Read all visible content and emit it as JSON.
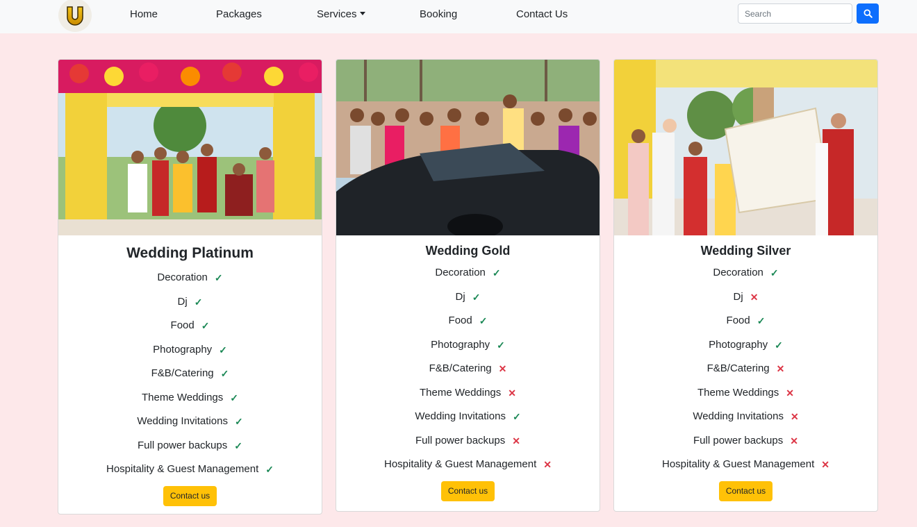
{
  "nav": {
    "logo_icon": "u-logo",
    "links": [
      {
        "label": "Home"
      },
      {
        "label": "Packages"
      },
      {
        "label": "Services"
      },
      {
        "label": "Booking"
      },
      {
        "label": "Contact Us"
      }
    ],
    "search_placeholder": "Search",
    "search_icon": "search-icon"
  },
  "colors": {
    "page_bg": "#fde8ea",
    "navbar_bg": "#f8f9fa",
    "primary": "#0d6efd",
    "warning": "#ffc107",
    "success": "#198754",
    "danger": "#dc3545"
  },
  "packages": [
    {
      "title": "Wedding Platinum",
      "features": [
        {
          "label": "Decoration",
          "included": true
        },
        {
          "label": "Dj",
          "included": true
        },
        {
          "label": "Food",
          "included": true
        },
        {
          "label": "Photography",
          "included": true
        },
        {
          "label": "F&B/Catering",
          "included": true
        },
        {
          "label": "Theme Weddings",
          "included": true
        },
        {
          "label": "Wedding Invitations",
          "included": true
        },
        {
          "label": "Full power backups",
          "included": true
        },
        {
          "label": "Hospitality & Guest Management",
          "included": true
        }
      ],
      "button": "Contact us"
    },
    {
      "title": "Wedding Gold",
      "features": [
        {
          "label": "Decoration",
          "included": true
        },
        {
          "label": "Dj",
          "included": true
        },
        {
          "label": "Food",
          "included": true
        },
        {
          "label": "Photography",
          "included": true
        },
        {
          "label": "F&B/Catering",
          "included": false
        },
        {
          "label": "Theme Weddings",
          "included": false
        },
        {
          "label": "Wedding Invitations",
          "included": true
        },
        {
          "label": "Full power backups",
          "included": false
        },
        {
          "label": "Hospitality & Guest Management",
          "included": false
        }
      ],
      "button": "Contact us"
    },
    {
      "title": "Wedding Silver",
      "features": [
        {
          "label": "Decoration",
          "included": true
        },
        {
          "label": "Dj",
          "included": false
        },
        {
          "label": "Food",
          "included": true
        },
        {
          "label": "Photography",
          "included": true
        },
        {
          "label": "F&B/Catering",
          "included": false
        },
        {
          "label": "Theme Weddings",
          "included": false
        },
        {
          "label": "Wedding Invitations",
          "included": false
        },
        {
          "label": "Full power backups",
          "included": false
        },
        {
          "label": "Hospitality & Guest Management",
          "included": false
        }
      ],
      "button": "Contact us"
    }
  ]
}
